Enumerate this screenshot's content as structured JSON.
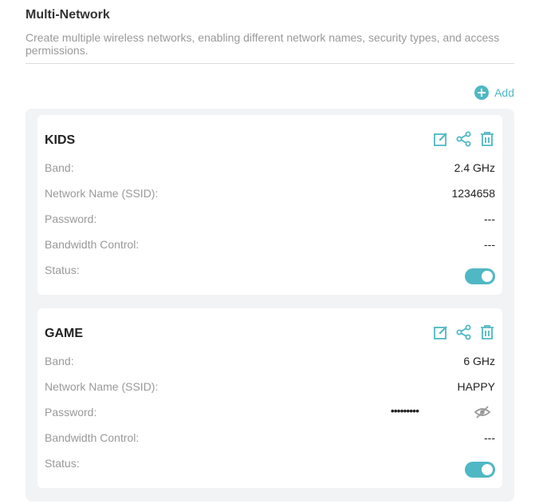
{
  "header": {
    "title": "Multi-Network",
    "description": "Create multiple wireless networks, enabling different network names, security types, and access permissions."
  },
  "add_label": "Add",
  "labels": {
    "band": "Band:",
    "ssid": "Network Name (SSID):",
    "password": "Password:",
    "bandwidth": "Bandwidth Control:",
    "status": "Status:"
  },
  "networks": [
    {
      "name": "KIDS",
      "band": "2.4 GHz",
      "ssid": "1234658",
      "password": "---",
      "bandwidth": "---",
      "status_on": true
    },
    {
      "name": "GAME",
      "band": "6 GHz",
      "ssid": "HAPPY",
      "password": "•••••••••",
      "bandwidth": "---",
      "status_on": true
    }
  ],
  "colors": {
    "accent": "#4fb8c4",
    "panel_bg": "#f2f3f5"
  },
  "icons": [
    "add-circle-icon",
    "edit-icon",
    "share-icon",
    "delete-icon",
    "eye-hidden-icon"
  ]
}
